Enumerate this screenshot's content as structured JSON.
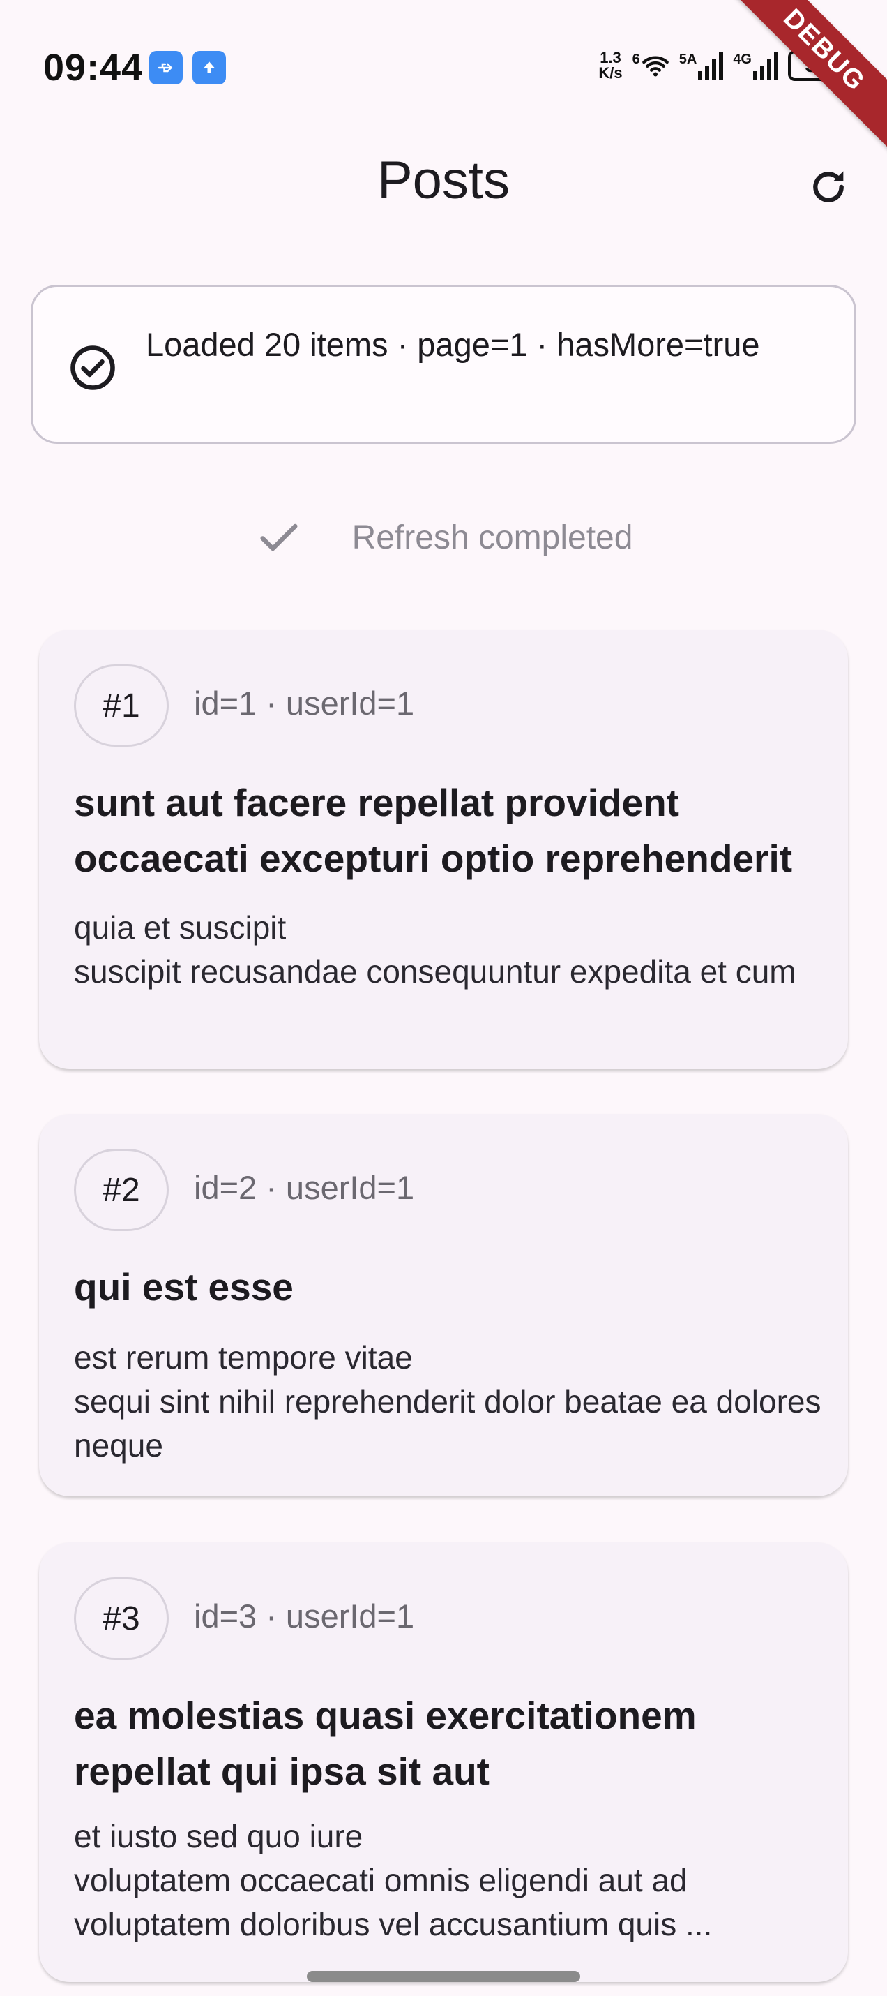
{
  "status_bar": {
    "time": "09:44",
    "net_speed_value": "1.3",
    "net_speed_unit": "K/s",
    "wifi_label": "6",
    "signal1_label": "5A",
    "signal2_label": "4G",
    "battery": "31"
  },
  "debug_banner": "DEBUG",
  "app_bar": {
    "title": "Posts",
    "refresh_icon": "refresh-icon"
  },
  "status_card": {
    "text": "Loaded 20 items · page=1 · hasMore=true",
    "icon": "check-circle-icon"
  },
  "refresh_indicator": {
    "text": "Refresh completed",
    "icon": "check-icon"
  },
  "posts": [
    {
      "badge": "#1",
      "meta": "id=1 · userId=1",
      "title": "sunt aut facere repellat provident occaecati excepturi optio reprehenderit",
      "body": "quia et suscipit\nsuscipit recusandae consequuntur expedita et cum"
    },
    {
      "badge": "#2",
      "meta": "id=2 · userId=1",
      "title": "qui est esse",
      "body": "est rerum tempore vitae\nsequi sint nihil reprehenderit dolor beatae ea dolores neque"
    },
    {
      "badge": "#3",
      "meta": "id=3 · userId=1",
      "title": "ea molestias quasi exercitationem repellat qui ipsa sit aut",
      "body": "et iusto sed quo iure\nvoluptatem occaecati omnis eligendi aut ad voluptatem doloribus vel accusantium quis ..."
    }
  ],
  "colors": {
    "background": "#fdf7fb",
    "card": "#f7f1f8",
    "accent_blue": "#3d8cf4",
    "debug_red": "#a8272c"
  }
}
